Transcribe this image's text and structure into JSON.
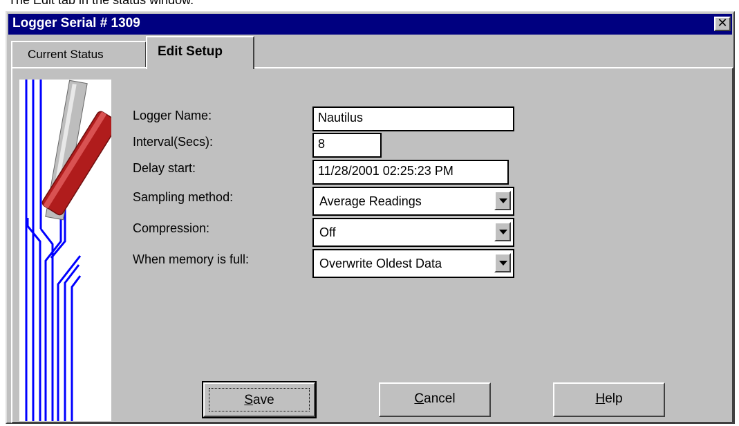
{
  "caption": "The Edit tab in the status window.",
  "window": {
    "title": "Logger Serial # 1309",
    "close_glyph": "✕"
  },
  "tabs": {
    "current_status": "Current Status",
    "edit_setup": "Edit Setup"
  },
  "form": {
    "logger_name": {
      "label": "Logger Name:",
      "value": "Nautilus"
    },
    "interval": {
      "label": "Interval(Secs):",
      "value": "8"
    },
    "delay_start": {
      "label": "Delay start:",
      "value": "11/28/2001 02:25:23 PM"
    },
    "sampling_method": {
      "label": "Sampling method:",
      "value": "Average Readings"
    },
    "compression": {
      "label": "Compression:",
      "value": "Off"
    },
    "memory_full": {
      "label": "When memory is full:",
      "value": "Overwrite Oldest Data"
    }
  },
  "buttons": {
    "save": {
      "mnemonic": "S",
      "rest": "ave"
    },
    "cancel": {
      "mnemonic": "C",
      "rest": "ancel"
    },
    "help": {
      "mnemonic": "H",
      "rest": "elp"
    }
  },
  "icons": {
    "close": "close-icon",
    "dropdown": "chevron-down-icon",
    "logger": "data-logger-icon"
  },
  "colors": {
    "title_bar": "#000080",
    "window_bg": "#c0c0c0",
    "circuit_lines": "#0000ff",
    "logger_body": "#b01c1c"
  }
}
